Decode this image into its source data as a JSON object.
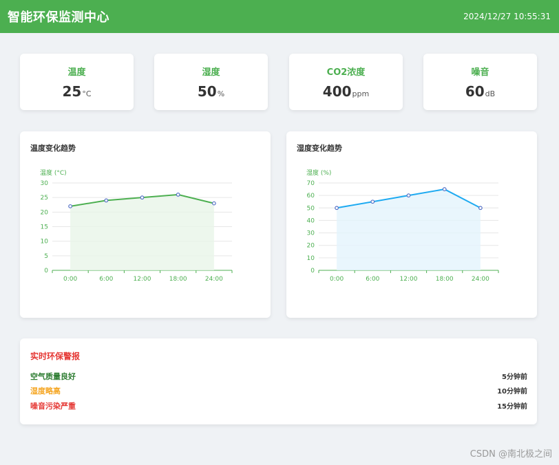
{
  "header": {
    "title": "智能环保监测中心",
    "time": "2024/12/27 10:55:31"
  },
  "stats": [
    {
      "label": "温度",
      "value": "25",
      "unit": "°C"
    },
    {
      "label": "湿度",
      "value": "50",
      "unit": "%"
    },
    {
      "label": "CO2浓度",
      "value": "400",
      "unit": "ppm"
    },
    {
      "label": "噪音",
      "value": "60",
      "unit": "dB"
    }
  ],
  "chart_data": [
    {
      "type": "area",
      "title": "温度变化趋势",
      "ylabel": "温度 (°C)",
      "x": [
        "0:00",
        "6:00",
        "12:00",
        "18:00",
        "24:00"
      ],
      "values": [
        22,
        24,
        25,
        26,
        23
      ],
      "ylim": [
        0,
        30
      ],
      "yticks": [
        0,
        5,
        10,
        15,
        20,
        25,
        30
      ],
      "color": "#4caf50",
      "fill": "#e8f5e9"
    },
    {
      "type": "area",
      "title": "湿度变化趋势",
      "ylabel": "湿度 (%)",
      "x": [
        "0:00",
        "6:00",
        "12:00",
        "18:00",
        "24:00"
      ],
      "values": [
        50,
        55,
        60,
        65,
        50
      ],
      "ylim": [
        0,
        70
      ],
      "yticks": [
        0,
        10,
        20,
        30,
        40,
        50,
        60,
        70
      ],
      "color": "#1eaaf1",
      "fill": "#e3f4fd"
    }
  ],
  "alerts": {
    "title": "实时环保警报",
    "items": [
      {
        "text": "空气质量良好",
        "time": "5分钟前",
        "color": "#2e7d32"
      },
      {
        "text": "湿度略高",
        "time": "10分钟前",
        "color": "#f5a623"
      },
      {
        "text": "噪音污染严重",
        "time": "15分钟前",
        "color": "#e53935"
      }
    ]
  },
  "watermark": "CSDN @南北极之间"
}
